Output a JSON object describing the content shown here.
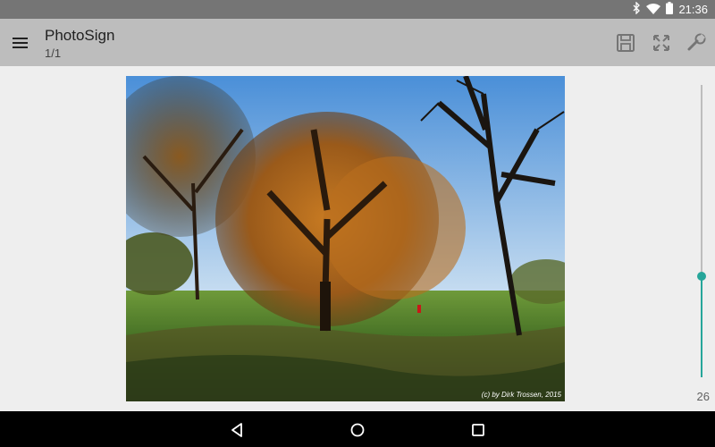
{
  "status_bar": {
    "time": "21:36",
    "icons": [
      "bluetooth-icon",
      "wifi-icon",
      "battery-icon"
    ]
  },
  "app_bar": {
    "title": "PhotoSign",
    "subtitle": "1/1",
    "actions": [
      "save-icon",
      "fullscreen-icon",
      "settings-wrench-icon"
    ]
  },
  "photo": {
    "watermark": "(c) by Dirk Trossen, 2015"
  },
  "slider": {
    "value": "26",
    "accent_color": "#26a69a"
  },
  "nav_bar": {
    "buttons": [
      "back-icon",
      "home-icon",
      "recents-icon"
    ]
  }
}
